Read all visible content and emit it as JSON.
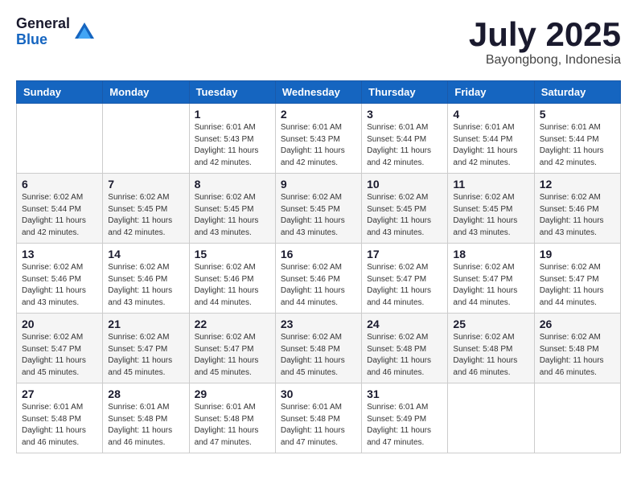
{
  "logo": {
    "general": "General",
    "blue": "Blue"
  },
  "title": "July 2025",
  "location": "Bayongbong, Indonesia",
  "days_of_week": [
    "Sunday",
    "Monday",
    "Tuesday",
    "Wednesday",
    "Thursday",
    "Friday",
    "Saturday"
  ],
  "weeks": [
    [
      {
        "day": "",
        "info": ""
      },
      {
        "day": "",
        "info": ""
      },
      {
        "day": "1",
        "info": "Sunrise: 6:01 AM\nSunset: 5:43 PM\nDaylight: 11 hours and 42 minutes."
      },
      {
        "day": "2",
        "info": "Sunrise: 6:01 AM\nSunset: 5:43 PM\nDaylight: 11 hours and 42 minutes."
      },
      {
        "day": "3",
        "info": "Sunrise: 6:01 AM\nSunset: 5:44 PM\nDaylight: 11 hours and 42 minutes."
      },
      {
        "day": "4",
        "info": "Sunrise: 6:01 AM\nSunset: 5:44 PM\nDaylight: 11 hours and 42 minutes."
      },
      {
        "day": "5",
        "info": "Sunrise: 6:01 AM\nSunset: 5:44 PM\nDaylight: 11 hours and 42 minutes."
      }
    ],
    [
      {
        "day": "6",
        "info": "Sunrise: 6:02 AM\nSunset: 5:44 PM\nDaylight: 11 hours and 42 minutes."
      },
      {
        "day": "7",
        "info": "Sunrise: 6:02 AM\nSunset: 5:45 PM\nDaylight: 11 hours and 42 minutes."
      },
      {
        "day": "8",
        "info": "Sunrise: 6:02 AM\nSunset: 5:45 PM\nDaylight: 11 hours and 43 minutes."
      },
      {
        "day": "9",
        "info": "Sunrise: 6:02 AM\nSunset: 5:45 PM\nDaylight: 11 hours and 43 minutes."
      },
      {
        "day": "10",
        "info": "Sunrise: 6:02 AM\nSunset: 5:45 PM\nDaylight: 11 hours and 43 minutes."
      },
      {
        "day": "11",
        "info": "Sunrise: 6:02 AM\nSunset: 5:45 PM\nDaylight: 11 hours and 43 minutes."
      },
      {
        "day": "12",
        "info": "Sunrise: 6:02 AM\nSunset: 5:46 PM\nDaylight: 11 hours and 43 minutes."
      }
    ],
    [
      {
        "day": "13",
        "info": "Sunrise: 6:02 AM\nSunset: 5:46 PM\nDaylight: 11 hours and 43 minutes."
      },
      {
        "day": "14",
        "info": "Sunrise: 6:02 AM\nSunset: 5:46 PM\nDaylight: 11 hours and 43 minutes."
      },
      {
        "day": "15",
        "info": "Sunrise: 6:02 AM\nSunset: 5:46 PM\nDaylight: 11 hours and 44 minutes."
      },
      {
        "day": "16",
        "info": "Sunrise: 6:02 AM\nSunset: 5:46 PM\nDaylight: 11 hours and 44 minutes."
      },
      {
        "day": "17",
        "info": "Sunrise: 6:02 AM\nSunset: 5:47 PM\nDaylight: 11 hours and 44 minutes."
      },
      {
        "day": "18",
        "info": "Sunrise: 6:02 AM\nSunset: 5:47 PM\nDaylight: 11 hours and 44 minutes."
      },
      {
        "day": "19",
        "info": "Sunrise: 6:02 AM\nSunset: 5:47 PM\nDaylight: 11 hours and 44 minutes."
      }
    ],
    [
      {
        "day": "20",
        "info": "Sunrise: 6:02 AM\nSunset: 5:47 PM\nDaylight: 11 hours and 45 minutes."
      },
      {
        "day": "21",
        "info": "Sunrise: 6:02 AM\nSunset: 5:47 PM\nDaylight: 11 hours and 45 minutes."
      },
      {
        "day": "22",
        "info": "Sunrise: 6:02 AM\nSunset: 5:47 PM\nDaylight: 11 hours and 45 minutes."
      },
      {
        "day": "23",
        "info": "Sunrise: 6:02 AM\nSunset: 5:48 PM\nDaylight: 11 hours and 45 minutes."
      },
      {
        "day": "24",
        "info": "Sunrise: 6:02 AM\nSunset: 5:48 PM\nDaylight: 11 hours and 46 minutes."
      },
      {
        "day": "25",
        "info": "Sunrise: 6:02 AM\nSunset: 5:48 PM\nDaylight: 11 hours and 46 minutes."
      },
      {
        "day": "26",
        "info": "Sunrise: 6:02 AM\nSunset: 5:48 PM\nDaylight: 11 hours and 46 minutes."
      }
    ],
    [
      {
        "day": "27",
        "info": "Sunrise: 6:01 AM\nSunset: 5:48 PM\nDaylight: 11 hours and 46 minutes."
      },
      {
        "day": "28",
        "info": "Sunrise: 6:01 AM\nSunset: 5:48 PM\nDaylight: 11 hours and 46 minutes."
      },
      {
        "day": "29",
        "info": "Sunrise: 6:01 AM\nSunset: 5:48 PM\nDaylight: 11 hours and 47 minutes."
      },
      {
        "day": "30",
        "info": "Sunrise: 6:01 AM\nSunset: 5:48 PM\nDaylight: 11 hours and 47 minutes."
      },
      {
        "day": "31",
        "info": "Sunrise: 6:01 AM\nSunset: 5:49 PM\nDaylight: 11 hours and 47 minutes."
      },
      {
        "day": "",
        "info": ""
      },
      {
        "day": "",
        "info": ""
      }
    ]
  ]
}
